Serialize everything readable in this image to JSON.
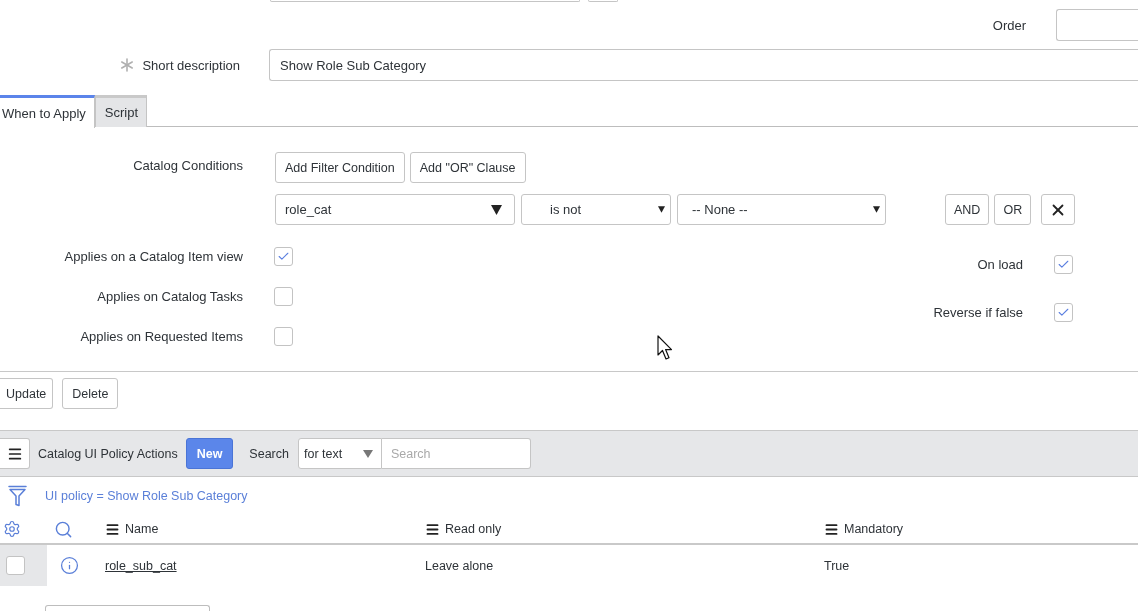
{
  "form": {
    "order": {
      "label": "Order"
    },
    "short_description": {
      "label": "Short description",
      "required": true,
      "value": "Show Role Sub Category"
    }
  },
  "tabs": [
    {
      "label": "When to Apply",
      "selected": true
    },
    {
      "label": "Script",
      "selected": false
    }
  ],
  "catalog_conditions": {
    "label": "Catalog Conditions",
    "buttons": [
      "Add Filter Condition",
      "Add \"OR\" Clause"
    ],
    "condition": {
      "field": "role_cat",
      "operator": "is not",
      "value": "-- None --"
    },
    "condition_buttons": [
      "AND",
      "OR"
    ]
  },
  "applies_options": [
    {
      "label": "Applies on a Catalog Item view",
      "checked": true
    },
    {
      "label": "Applies on Catalog Tasks",
      "checked": false
    },
    {
      "label": "Applies on Requested Items",
      "checked": false
    }
  ],
  "load_options": [
    {
      "label": "On load",
      "checked": true
    },
    {
      "label": "Reverse if false",
      "checked": true
    }
  ],
  "form_buttons": [
    "Update",
    "Delete"
  ],
  "related_list": {
    "title": "Catalog UI Policy Actions",
    "new_button": "New",
    "search_label": "Search",
    "search_scope": "for text",
    "search_placeholder": "Search",
    "filter": "UI policy = Show Role Sub Category",
    "columns": [
      "Name",
      "Read only",
      "Mandatory"
    ],
    "rows": [
      {
        "selected": false,
        "cells": [
          {
            "kind": "link",
            "text": "role_sub_cat"
          },
          {
            "kind": "text",
            "text": "Leave alone"
          },
          {
            "kind": "text",
            "text": "True"
          }
        ]
      }
    ]
  }
}
